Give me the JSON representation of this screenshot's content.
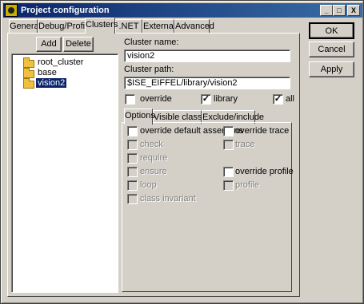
{
  "window": {
    "title": "Project configuration",
    "minimize": "_",
    "maximize": "□",
    "close": "X"
  },
  "tabs": [
    {
      "label": "General"
    },
    {
      "label": "Debug/Profile"
    },
    {
      "label": "Clusters"
    },
    {
      "label": ".NET"
    },
    {
      "label": "Externals"
    },
    {
      "label": "Advanced"
    }
  ],
  "actions": {
    "ok": "OK",
    "cancel": "Cancel",
    "apply": "Apply"
  },
  "clusters": {
    "add": "Add",
    "delete": "Delete",
    "tree": [
      {
        "label": "root_cluster"
      },
      {
        "label": "base"
      },
      {
        "label": "vision2"
      }
    ],
    "selected": "vision2",
    "name_label": "Cluster name:",
    "name_value": "vision2",
    "path_label": "Cluster path:",
    "path_value": "$ISE_EIFFEL/library/vision2",
    "override_label": "override",
    "override_checked": "",
    "library_label": "library",
    "library_checked": "✓",
    "all_label": "all",
    "all_checked": "✓"
  },
  "subtabs": [
    {
      "label": "Options"
    },
    {
      "label": "Visible classes"
    },
    {
      "label": "Exclude/include"
    }
  ],
  "options": {
    "override_assertions": "override default assertions",
    "check": "check",
    "require": "require",
    "ensure": "ensure",
    "loop": "loop",
    "class_invariant": "class invariant",
    "override_trace": "override trace",
    "trace": "trace",
    "override_profile": "override profile",
    "profile": "profile"
  }
}
